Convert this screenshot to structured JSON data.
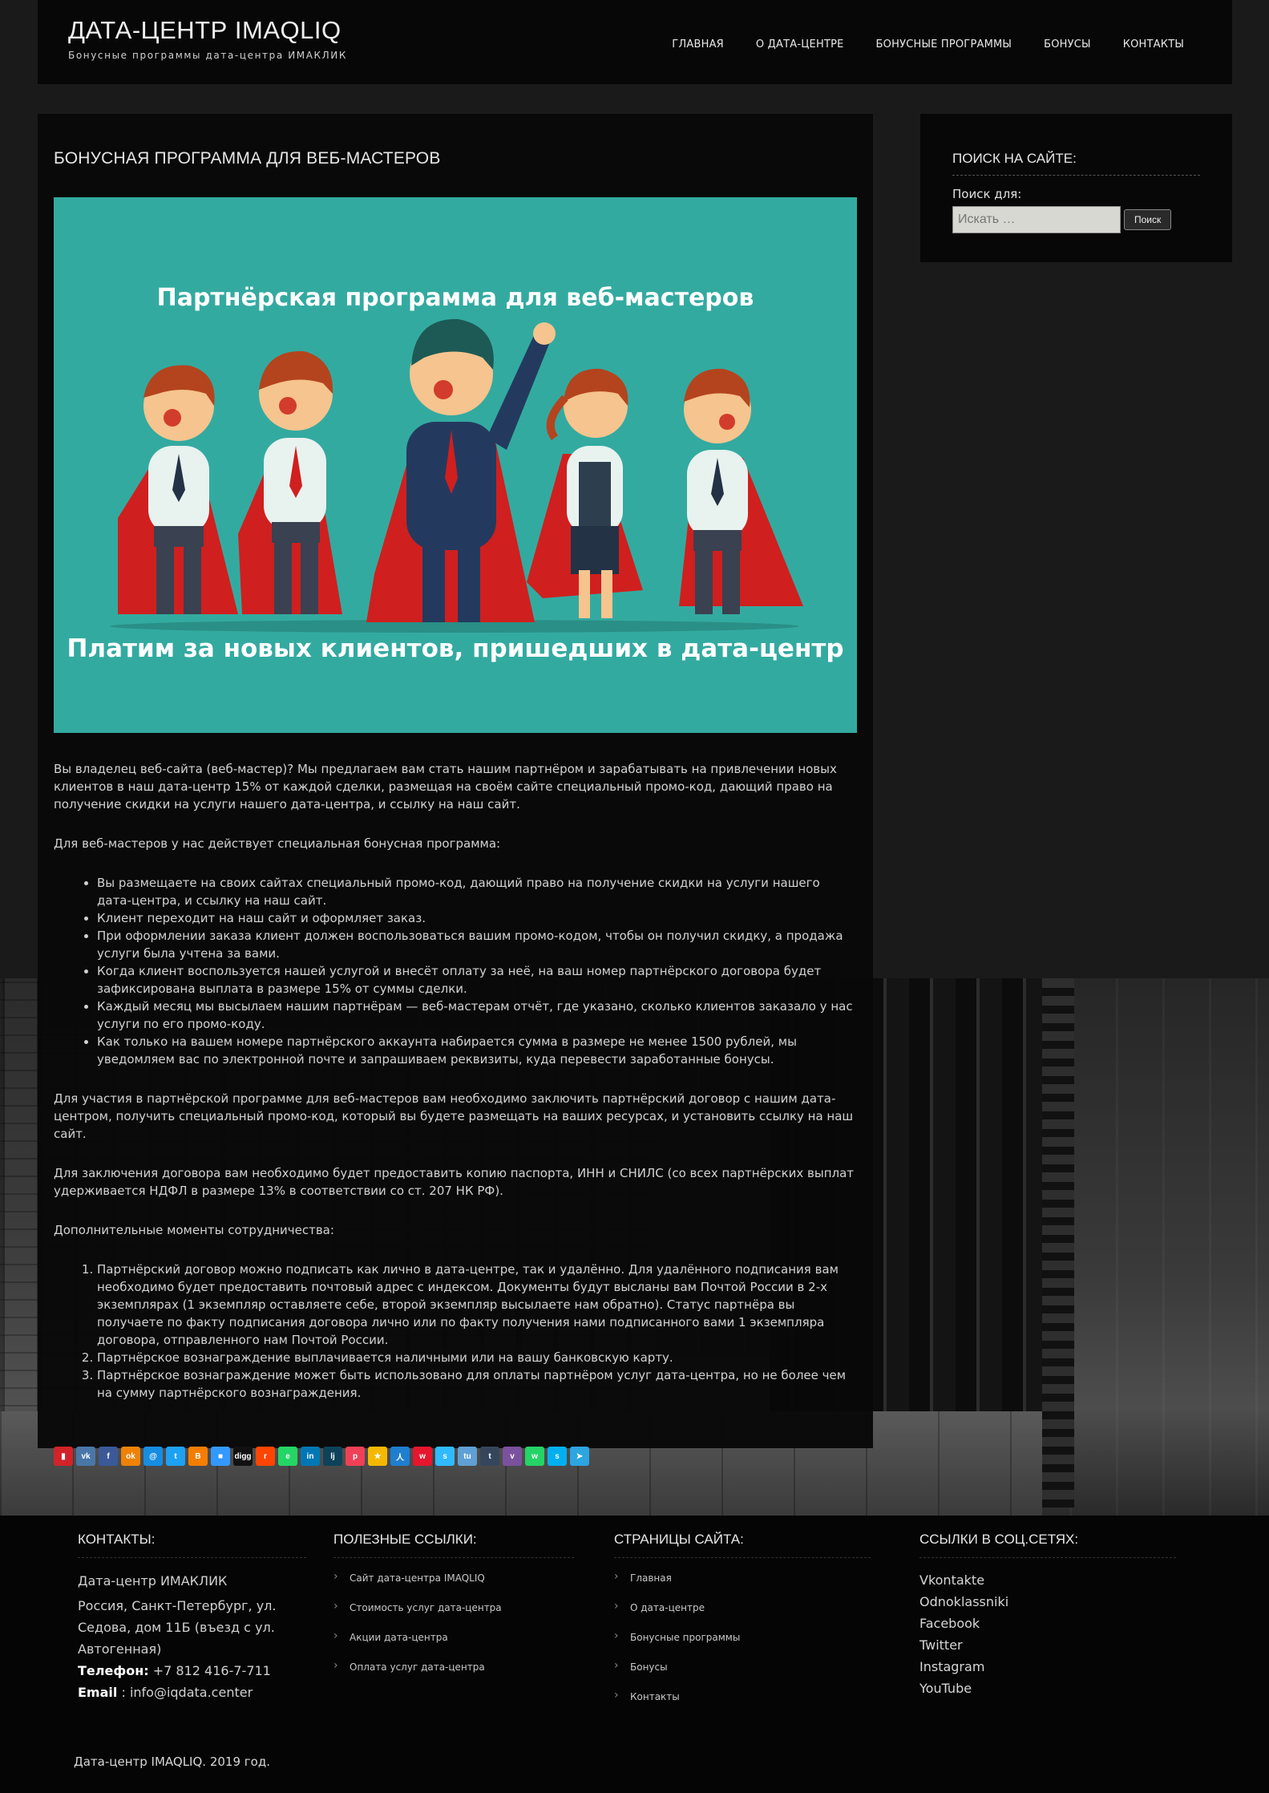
{
  "header": {
    "site_title": "ДАТА-ЦЕНТР IMAQLIQ",
    "tagline": "Бонусные программы дата-центра ИМАКЛИК",
    "nav": [
      "ГЛАВНАЯ",
      "О ДАТА-ЦЕНТРЕ",
      "БОНУСНЫЕ ПРОГРАММЫ",
      "БОНУСЫ",
      "КОНТАКТЫ"
    ]
  },
  "post": {
    "title": "БОНУСНАЯ ПРОГРАММА ДЛЯ ВЕБ-МАСТЕРОВ",
    "hero_title": "Партнёрская программа для веб-мастеров",
    "hero_caption": "Платим за новых клиентов, пришедших в дата-центр",
    "p1": "Вы владелец веб-сайта (веб-мастер)? Мы предлагаем вам стать нашим партнёром и зарабатывать на привлечении новых клиентов в наш дата-центр 15% от каждой сделки, размещая на своём сайте специальный промо-код, дающий право на получение скидки на услуги нашего дата-центра, и ссылку на наш сайт.",
    "p2": "Для веб-мастеров у нас действует специальная бонусная программа:",
    "bullets": [
      "Вы размещаете на своих сайтах специальный промо-код, дающий право на получение скидки на услуги нашего дата-центра, и ссылку на наш сайт.",
      "Клиент переходит на наш сайт и оформляет заказ.",
      "При оформлении заказа клиент должен воспользоваться вашим промо-кодом, чтобы он получил скидку, а продажа услуги была учтена за вами.",
      "Когда клиент воспользуется нашей услугой и внесёт оплату за неё, на ваш номер партнёрского договора будет зафиксирована выплата в размере 15% от суммы сделки.",
      "Каждый месяц мы высылаем нашим партнёрам — веб-мастерам отчёт, где указано, сколько клиентов заказало у нас услуги по его промо-коду.",
      "Как только на вашем номере партнёрского аккаунта набирается сумма в размере не менее 1500 рублей, мы уведомляем вас по электронной почте и запрашиваем реквизиты, куда перевести заработанные бонусы."
    ],
    "p3": "Для участия в партнёрской программе для веб-мастеров вам необходимо заключить партнёрский договор с нашим дата-центром, получить специальный промо-код, который вы будете размещать на ваших ресурсах, и установить ссылку на наш сайт.",
    "p4": "Для заключения договора вам необходимо будет предоставить копию паспорта, ИНН и СНИЛС (со всех партнёрских выплат удерживается НДФЛ в размере 13% в соответствии со ст. 207 НК РФ).",
    "p5": "Дополнительные моменты сотрудничества:",
    "numbered": [
      "Партнёрский договор можно подписать как лично в дата-центре, так и удалённо. Для удалённого подписания вам необходимо будет предоставить почтовый адрес с индексом. Документы будут высланы вам Почтой России в 2-х экземплярах (1 экземпляр оставляете себе, второй экземпляр высылаете нам обратно). Статус партнёра вы получаете по факту подписания договора лично или по факту получения нами подписанного вами 1 экземпляра договора, отправленного нам Почтой России.",
      "Партнёрское вознаграждение выплачивается наличными или на вашу банковскую карту.",
      "Партнёрское вознаграждение может быть использовано для оплаты партнёром услуг дата-центра, но не более чем на сумму партнёрского вознаграждения."
    ]
  },
  "share_buttons": [
    {
      "name": "bookmark",
      "glyph": "▮",
      "color": "#d2232a"
    },
    {
      "name": "vk",
      "glyph": "vk",
      "color": "#4a76a8"
    },
    {
      "name": "facebook",
      "glyph": "f",
      "color": "#3b5998"
    },
    {
      "name": "odnoklassniki",
      "glyph": "ok",
      "color": "#ee8208"
    },
    {
      "name": "mail-ru",
      "glyph": "@",
      "color": "#168de2"
    },
    {
      "name": "twitter",
      "glyph": "t",
      "color": "#1da1f2"
    },
    {
      "name": "blogger",
      "glyph": "B",
      "color": "#f57d00"
    },
    {
      "name": "delicious",
      "glyph": "■",
      "color": "#3399ff"
    },
    {
      "name": "digg",
      "glyph": "digg",
      "color": "#111111"
    },
    {
      "name": "reddit",
      "glyph": "r",
      "color": "#ff4500"
    },
    {
      "name": "evernote",
      "glyph": "e",
      "color": "#24d666"
    },
    {
      "name": "linkedin",
      "glyph": "in",
      "color": "#0077b5"
    },
    {
      "name": "livejournal",
      "glyph": "lj",
      "color": "#0d425a"
    },
    {
      "name": "pocket",
      "glyph": "p",
      "color": "#ef4056"
    },
    {
      "name": "qzone",
      "glyph": "★",
      "color": "#f5b800"
    },
    {
      "name": "renren",
      "glyph": "人",
      "color": "#1f7ed0"
    },
    {
      "name": "weibo",
      "glyph": "w",
      "color": "#e6162d"
    },
    {
      "name": "surfingbird",
      "glyph": "s",
      "color": "#30baff"
    },
    {
      "name": "tuenti",
      "glyph": "tu",
      "color": "#5fa0d5"
    },
    {
      "name": "tumblr",
      "glyph": "t",
      "color": "#35465c"
    },
    {
      "name": "viber",
      "glyph": "v",
      "color": "#7b519d"
    },
    {
      "name": "whatsapp",
      "glyph": "w",
      "color": "#25d366"
    },
    {
      "name": "skype",
      "glyph": "s",
      "color": "#00aff0"
    },
    {
      "name": "telegram",
      "glyph": "➤",
      "color": "#2ca5e0"
    }
  ],
  "sidebar": {
    "widget_title": "ПОИСК НА САЙТЕ:",
    "search_label": "Поиск для:",
    "search_placeholder": "Искать …",
    "search_button": "Поиск"
  },
  "footer": {
    "contacts": {
      "title": "КОНТАКТЫ:",
      "name": "Дата-центр ИМАКЛИК",
      "address": "Россия, Санкт-Петербург, ул. Седова, дом 11Б (въезд с ул. Автогенная)",
      "phone_label": "Телефон:",
      "phone": "+7 812 416-7-711",
      "email_label": "Email",
      "email": ": info@iqdata.center"
    },
    "useful_links": {
      "title": "ПОЛЕЗНЫЕ ССЫЛКИ:",
      "items": [
        "Сайт дата-центра IMAQLIQ",
        "Стоимость услуг дата-центра",
        "Акции дата-центра",
        "Оплата услуг дата-центра"
      ]
    },
    "site_pages": {
      "title": "СТРАНИЦЫ САЙТА:",
      "items": [
        "Главная",
        "О дата-центре",
        "Бонусные программы",
        "Бонусы",
        "Контакты"
      ]
    },
    "social_links": {
      "title": "ССЫЛКИ В СОЦ.СЕТЯХ:",
      "items": [
        "Vkontakte",
        "Odnoklassniki",
        "Facebook",
        "Twitter",
        "Instagram",
        "YouTube"
      ]
    },
    "copyright": "Дата-центр IMAQLIQ. 2019 год."
  }
}
